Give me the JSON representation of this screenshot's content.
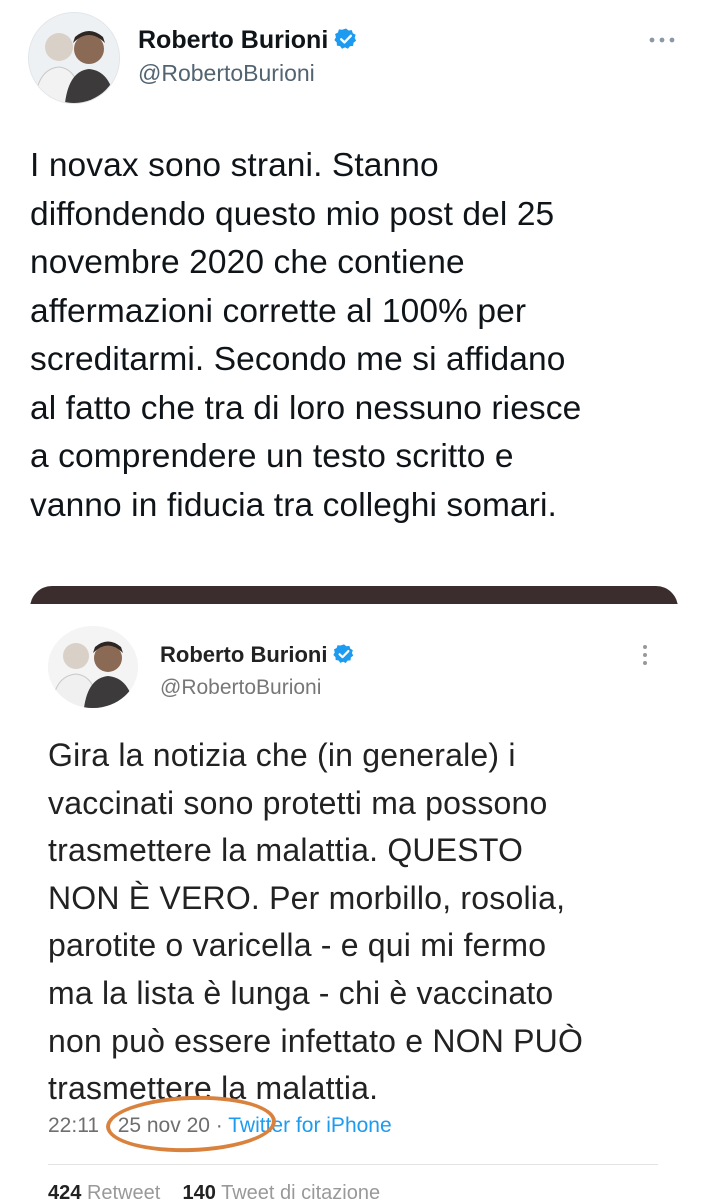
{
  "tweet": {
    "author_name": "Roberto Burioni",
    "handle": "@RobertoBurioni",
    "text": "I novax sono strani. Stanno\ndiffondendo questo mio post del 25\nnovembre 2020 che contiene\naffermazioni corrette al 100% per\nscreditarmi. Secondo me si affidano\nal fatto che tra di loro nessuno riesce\na comprendere un testo scritto e\nvanno in fiducia tra colleghi somari."
  },
  "quoted": {
    "author_name": "Roberto Burioni",
    "handle": "@RobertoBurioni",
    "text": "Gira la notizia che (in generale) i\nvaccinati sono protetti ma possono\ntrasmettere la malattia. QUESTO\nNON È VERO. Per morbillo, rosolia,\nparotite o varicella - e qui mi fermo\nma la lista è lunga - chi è vaccinato\nnon può essere infettato e NON PUÒ\ntrasmettere la malattia.",
    "time": "22:11",
    "date": "25 nov 20",
    "separator": "·",
    "source": "Twitter for iPhone",
    "retweets_count": "424",
    "retweets_label": "Retweet",
    "quotes_count": "140",
    "quotes_label": "Tweet di citazione"
  },
  "colors": {
    "verified": "#1d9bf0",
    "highlight_circle": "#d9823e",
    "link": "#1d9bf0"
  },
  "icons": [
    "verified-badge-icon",
    "more-icon"
  ]
}
